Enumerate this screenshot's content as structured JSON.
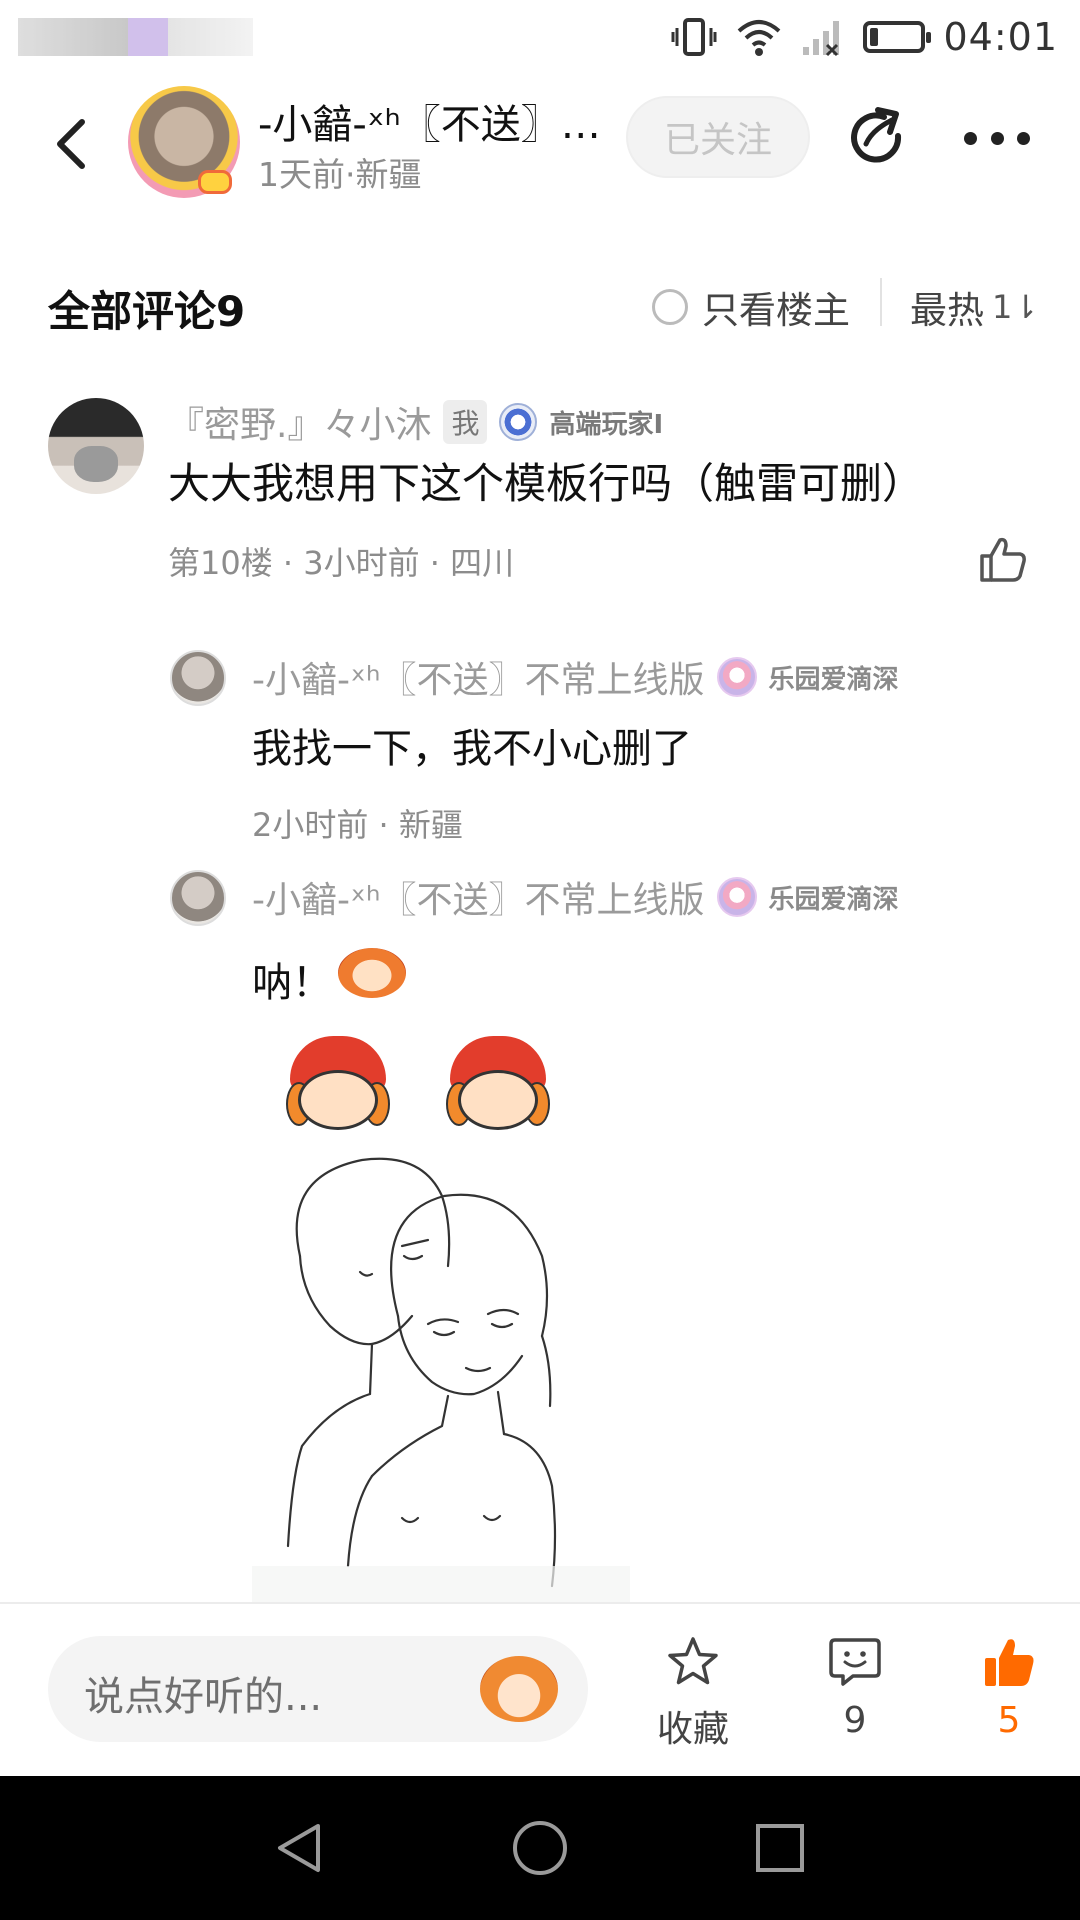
{
  "status_bar": {
    "time": "04:01"
  },
  "header": {
    "author_name": "-小韽-ˣʰ〖不送〗不常…",
    "author_meta": "1天前·新疆",
    "follow_label": "已关注"
  },
  "comments": {
    "title": "全部评论9",
    "op_only_label": "只看楼主",
    "sort_label": "最热",
    "sort_icon": "1⇂"
  },
  "comment": {
    "author": "『密野.』々小沐",
    "me_badge": "我",
    "level_label": "高端玩家I",
    "text": "大大我想用下这个模板行吗（触雷可删）",
    "meta": "第10楼 · 3小时前 · 四川"
  },
  "replies": [
    {
      "author": "-小韽-ˣʰ〖不送〗不常上线版",
      "badge": "乐园爱滴深",
      "text": "我找一下，我不小心删了",
      "meta": "2小时前 · 新疆"
    },
    {
      "author": "-小韽-ˣʰ〖不送〗不常上线版",
      "badge": "乐园爱滴深",
      "text": "呐！"
    }
  ],
  "bottom_bar": {
    "input_placeholder": "说点好听的...",
    "favorite_label": "收藏",
    "comment_count": "9",
    "like_count": "5"
  },
  "colors": {
    "accent": "#ff6a00",
    "muted_text": "#8c8c8c",
    "follow_bg": "#f3f3f3"
  },
  "icons": [
    "back-arrow-icon",
    "share-icon",
    "more-icon",
    "radio-icon",
    "sort-icon",
    "thumbs-up-icon",
    "star-icon",
    "chat-icon",
    "nav-back-icon",
    "nav-home-icon",
    "nav-recents-icon"
  ]
}
